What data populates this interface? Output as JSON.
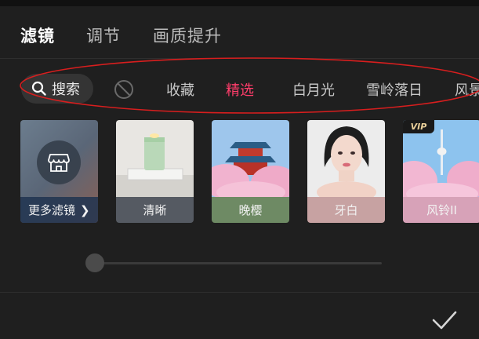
{
  "header": {
    "tabs": [
      {
        "label": "滤镜",
        "active": true
      },
      {
        "label": "调节",
        "active": false
      },
      {
        "label": "画质提升",
        "active": false
      }
    ]
  },
  "categories": {
    "search_label": "搜索",
    "items": [
      {
        "label": "收藏",
        "active": false
      },
      {
        "label": "精选",
        "active": true
      },
      {
        "label": "白月光",
        "active": false
      },
      {
        "label": "雪岭落日",
        "active": false
      },
      {
        "label": "风景",
        "active": false
      }
    ]
  },
  "filters": {
    "more_label": "更多滤镜",
    "cards": [
      {
        "label": "清晰",
        "vip": false
      },
      {
        "label": "晚樱",
        "vip": false
      },
      {
        "label": "牙白",
        "vip": false
      },
      {
        "label": "风铃II",
        "vip": true
      }
    ],
    "vip_badge": "VIP"
  },
  "slider": {
    "value": 0
  },
  "colors": {
    "accent": "#ff3d6b",
    "annotation": "#d81e1e",
    "background": "#1f1f1f"
  }
}
